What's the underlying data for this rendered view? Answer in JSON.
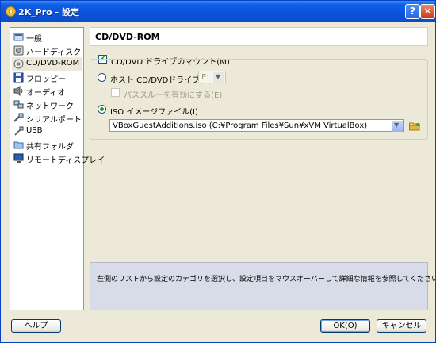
{
  "window": {
    "title": "2K_Pro - 設定",
    "help_button": "?",
    "close_button": "✕"
  },
  "sidebar": {
    "items": [
      {
        "label": "一般",
        "icon": "general-icon"
      },
      {
        "label": "ハードディスク",
        "icon": "hard-disk-icon"
      },
      {
        "label": "CD/DVD-ROM",
        "icon": "cd-dvd-icon",
        "selected": true
      },
      {
        "label": "フロッピー",
        "icon": "floppy-icon"
      },
      {
        "label": "オーディオ",
        "icon": "audio-icon"
      },
      {
        "label": "ネットワーク",
        "icon": "network-icon"
      },
      {
        "label": "シリアルポート",
        "icon": "serial-port-icon"
      },
      {
        "label": "USB",
        "icon": "usb-icon"
      },
      {
        "label": "共有フォルダ",
        "icon": "shared-folder-icon"
      },
      {
        "label": "リモートディスプレイ",
        "icon": "remote-display-icon"
      }
    ]
  },
  "main": {
    "header": "CD/DVD-ROM",
    "mount_checkbox": {
      "label": "CD/DVD ドライブのマウント(M)",
      "checked": true
    },
    "host_drive_radio": {
      "label": "ホスト CD/DVDドライブ(D)",
      "selected": false
    },
    "host_drive_combo": {
      "value": "E:"
    },
    "passthrough_checkbox": {
      "label": "パススルーを有効にする(E)",
      "checked": false
    },
    "iso_radio": {
      "label": "ISO イメージファイル(I)",
      "selected": true
    },
    "iso_combo": {
      "value": "VBoxGuestAdditions.iso (C:¥Program Files¥Sun¥xVM VirtualBox)"
    },
    "info_text": "左側のリストから設定のカテゴリを選択し、設定項目をマウスオーバーして詳細な情報を参照してください。"
  },
  "footer": {
    "help": "ヘルプ",
    "ok": "OK(O)",
    "cancel": "キャンセル"
  },
  "colors": {
    "titlebar": "#0a53d9",
    "checkmark": "#21a121",
    "info_bg": "#d8dce8"
  }
}
